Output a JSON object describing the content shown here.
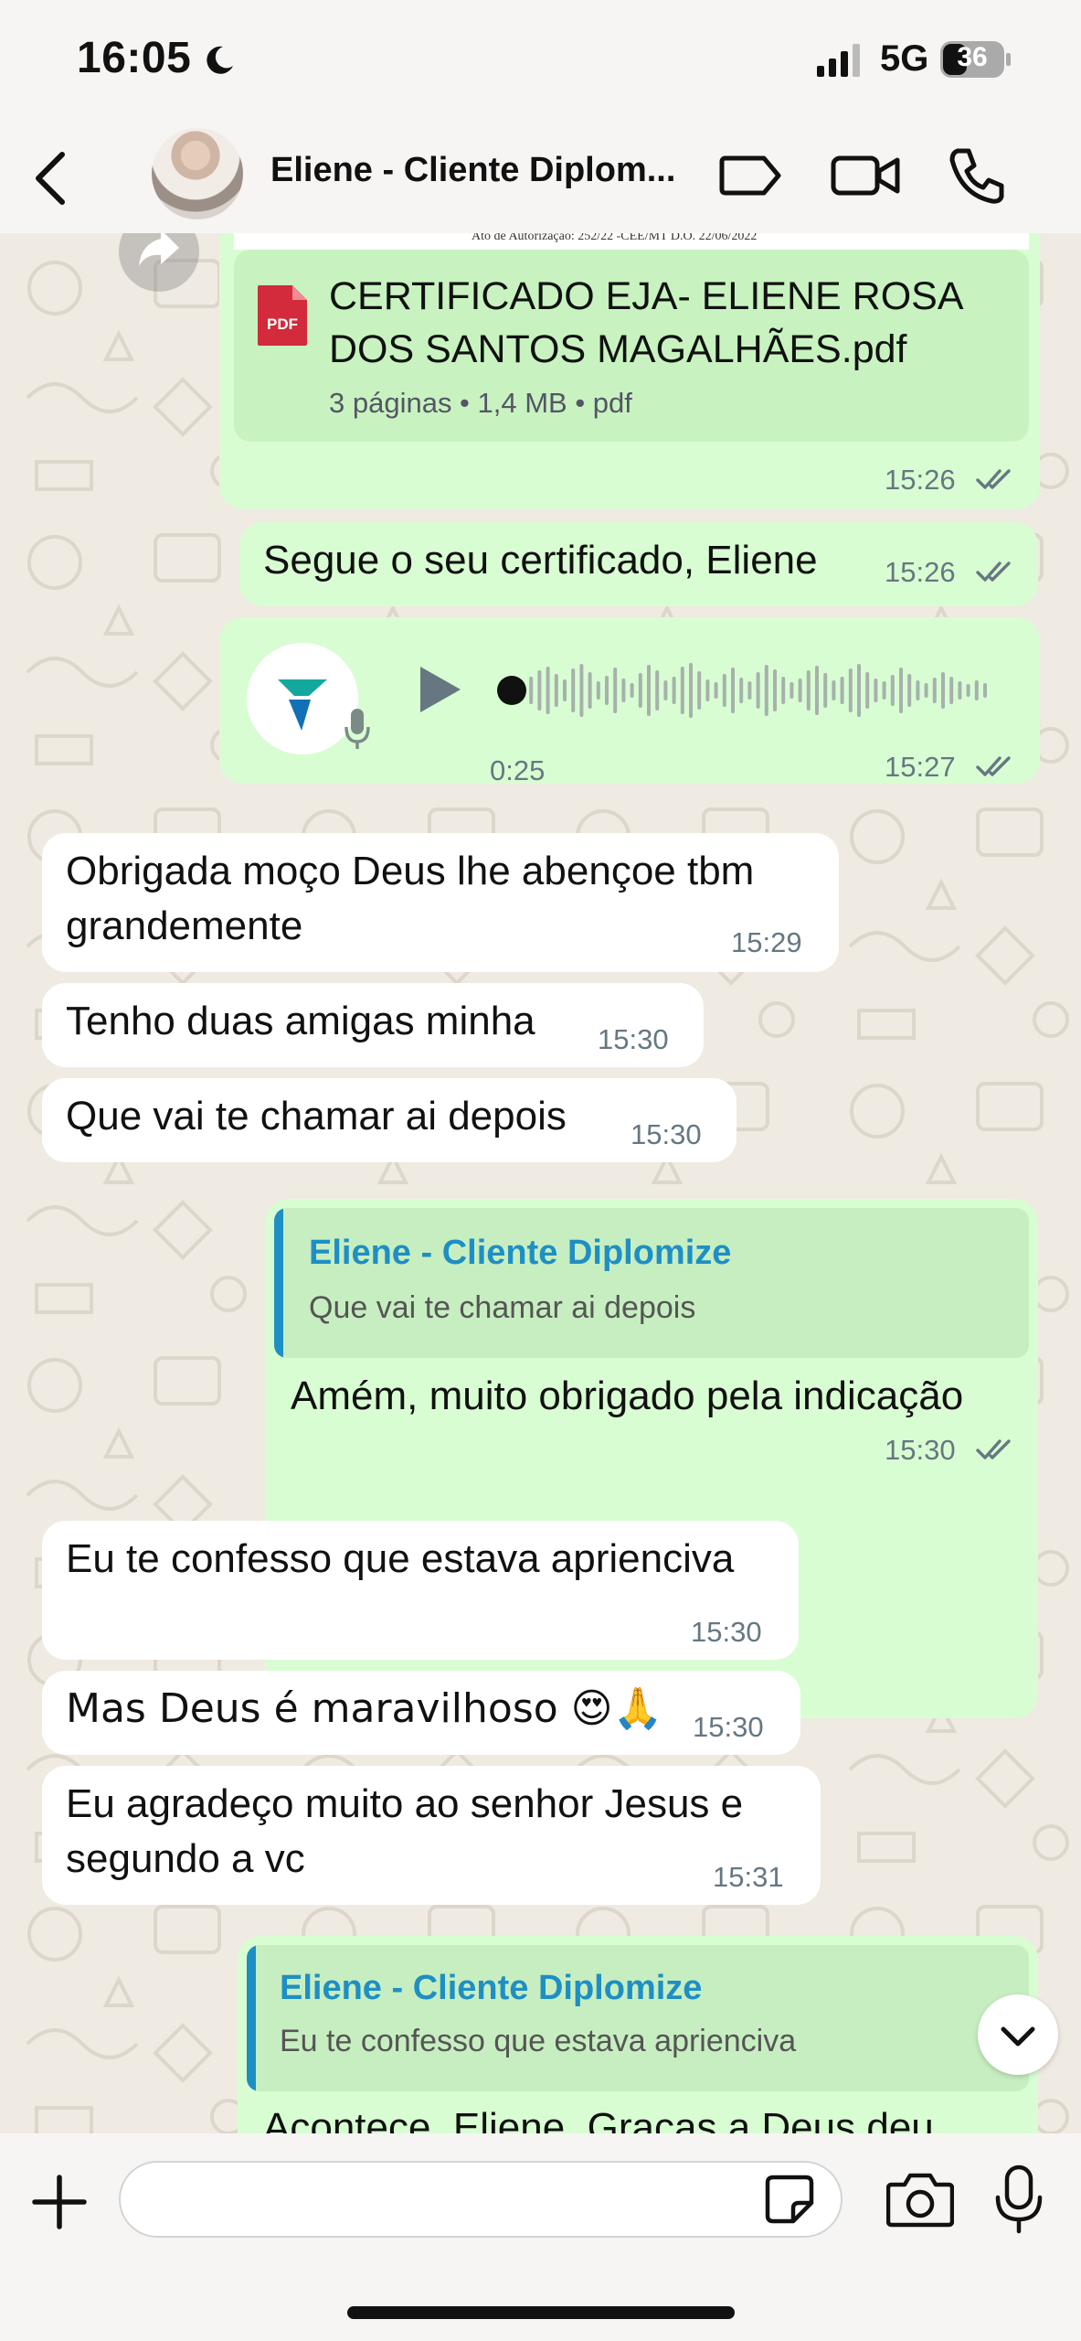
{
  "status_bar": {
    "time": "16:05",
    "network": "5G",
    "battery": "36",
    "icons": [
      "moon-icon",
      "signal-icon",
      "battery-icon"
    ]
  },
  "header": {
    "contact_name": "Eliene - Cliente Diplom...",
    "icons": [
      "back-icon",
      "label-icon",
      "video-call-icon",
      "voice-call-icon"
    ]
  },
  "messages": {
    "doc": {
      "name": "CERTIFICADO EJA- ELIENE ROSA DOS SANTOS MAGALHÃES.pdf",
      "name_line1": "CERTIFICADO EJA- ELIENE ROSA",
      "name_line2": "DOS SANTOS MAGALHÃES.pdf",
      "meta": "3 páginas • 1,4 MB • pdf",
      "pdf_badge": "PDF",
      "preview_caption": "Ato de Autorização: 252/22 -CEE/MT D.O. 22/06/2022",
      "time": "15:26"
    },
    "m1": {
      "text": "Segue o seu certificado, Eliene",
      "time": "15:26"
    },
    "voice": {
      "duration": "0:25",
      "time": "15:27",
      "progress": 0
    },
    "m2": {
      "line1": "Obrigada moço Deus lhe abençoe tbm",
      "line2": "grandemente",
      "time": "15:29"
    },
    "m3": {
      "text": "Tenho duas amigas minha",
      "time": "15:30"
    },
    "m4": {
      "text": "Que vai te chamar ai depois",
      "time": "15:30"
    },
    "m5": {
      "reply_name": "Eliene - Cliente Diplomize",
      "reply_text": "Que vai te chamar ai depois",
      "text": "Amém, muito obrigado pela indicação",
      "time": "15:30"
    },
    "m6": {
      "text": "Eu te confesso que estava aprienciva",
      "time": "15:30"
    },
    "m7": {
      "text": "Mas Deus é maravilhoso 😍🙏",
      "time": "15:30"
    },
    "m8": {
      "line1": "Eu agradeço muito ao senhor Jesus e",
      "line2": "segundo a vc",
      "time": "15:31"
    },
    "m9": {
      "reply_name": "Eliene - Cliente Diplomize",
      "reply_text": "Eu te confesso que estava aprienciva",
      "text": "Acontece, Eliene. Graças a Deus deu"
    }
  },
  "input": {
    "placeholder": "",
    "value": ""
  },
  "colors": {
    "wallpaper": "#efeae2",
    "incoming": "#ffffff",
    "outgoing": "#d9fdd3",
    "accent_blue": "#1e8fc4",
    "read_ticks": "#667781",
    "pdf_red": "#d32a3c"
  }
}
